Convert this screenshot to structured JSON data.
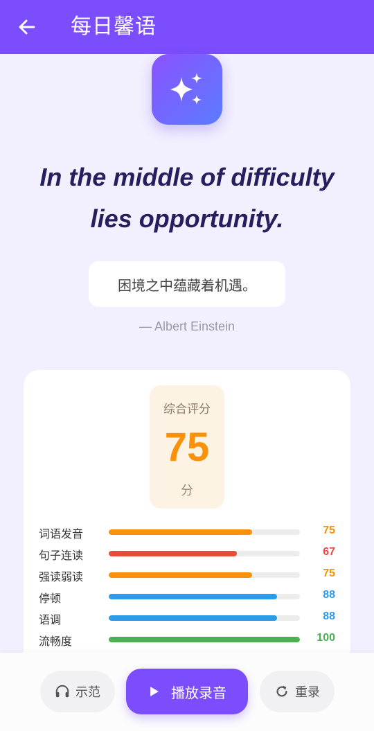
{
  "header": {
    "title": "每日馨语",
    "back_icon": "arrow-left-icon"
  },
  "hero": {
    "icon": "sparkles-icon"
  },
  "quote": {
    "line1": "In the middle of difficulty",
    "line2": "lies opportunity.",
    "translation": "困境之中蕴藏着机遇。",
    "author": "— Albert Einstein"
  },
  "score": {
    "label": "综合评分",
    "value": "75",
    "unit": "分",
    "metrics": [
      {
        "name": "词语发音",
        "value": "75",
        "fraction": 0.75,
        "color": "#f7920a"
      },
      {
        "name": "句子连读",
        "value": "67",
        "fraction": 0.67,
        "color": "#e84a3c"
      },
      {
        "name": "强读弱读",
        "value": "75",
        "fraction": 0.75,
        "color": "#f7920a"
      },
      {
        "name": "停顿",
        "value": "88",
        "fraction": 0.88,
        "color": "#2c9be8"
      },
      {
        "name": "语调",
        "value": "88",
        "fraction": 0.88,
        "color": "#2c9be8"
      },
      {
        "name": "流畅度",
        "value": "100",
        "fraction": 1.0,
        "color": "#4caf50"
      }
    ]
  },
  "actions": {
    "demo_label": "示范",
    "play_label": "播放录音",
    "redo_label": "重录"
  },
  "colors": {
    "primary": "#7b4dfc",
    "background": "#f2effe",
    "score_orange": "#f7920a"
  }
}
